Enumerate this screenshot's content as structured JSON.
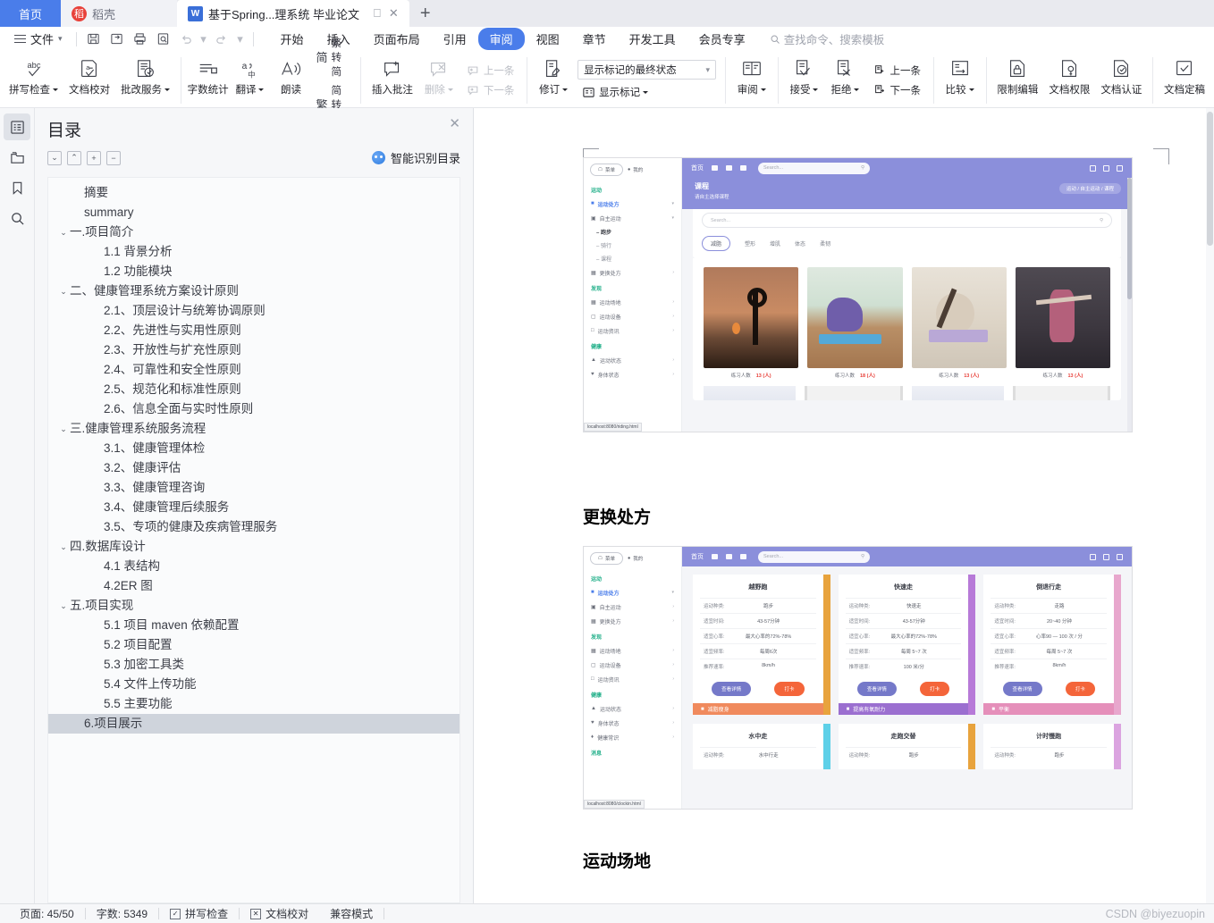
{
  "window": {
    "tabs": [
      {
        "label": "首页",
        "kind": "home"
      },
      {
        "label": "稻壳",
        "kind": "daoke",
        "icon": "daoke-icon"
      },
      {
        "label": "基于Spring...理系统 毕业论文",
        "kind": "document",
        "icon": "wps-writer-icon"
      }
    ],
    "new_tab_label": "+",
    "restore_icon": "restore-icon",
    "close_icon": "close-icon"
  },
  "menubar": {
    "file_label": "文件",
    "quick_access": [
      "save-icon",
      "save-as-icon",
      "print-icon",
      "print-preview-icon",
      "undo-icon",
      "redo-icon",
      "customize-icon"
    ],
    "tabs": [
      {
        "label": "开始",
        "active": false
      },
      {
        "label": "插入",
        "active": false
      },
      {
        "label": "页面布局",
        "active": false
      },
      {
        "label": "引用",
        "active": false
      },
      {
        "label": "审阅",
        "active": true
      },
      {
        "label": "视图",
        "active": false
      },
      {
        "label": "章节",
        "active": false
      },
      {
        "label": "开发工具",
        "active": false
      },
      {
        "label": "会员专享",
        "active": false
      }
    ],
    "search_placeholder": "查找命令、搜索模板",
    "search_icon": "search-icon",
    "accent_color": "#4a7dea"
  },
  "ribbon": {
    "groups": [
      {
        "items": [
          {
            "label": "拼写检查",
            "icon": "spell-check-icon",
            "dropdown": true,
            "disabled": false
          },
          {
            "label": "文档校对",
            "icon": "document-proof-icon",
            "dropdown": false,
            "disabled": false
          },
          {
            "label": "批改服务",
            "icon": "correction-service-icon",
            "dropdown": true,
            "disabled": false
          }
        ]
      },
      {
        "items": [
          {
            "label": "字数统计",
            "icon": "word-count-icon",
            "dropdown": false,
            "disabled": false
          },
          {
            "label": "翻译",
            "icon": "translate-icon",
            "dropdown": true,
            "disabled": false
          },
          {
            "label": "朗读",
            "icon": "read-aloud-icon",
            "dropdown": false,
            "disabled": false
          }
        ],
        "stacked": [
          {
            "label": "繁转简",
            "icon": "trad-to-simp-icon",
            "glyph": "简"
          },
          {
            "label": "简转繁",
            "icon": "simp-to-trad-icon",
            "glyph": "繁"
          }
        ]
      },
      {
        "items": [
          {
            "label": "插入批注",
            "icon": "insert-comment-icon",
            "dropdown": false,
            "disabled": false
          },
          {
            "label": "删除",
            "icon": "delete-comment-icon",
            "dropdown": true,
            "disabled": true
          }
        ],
        "small": [
          {
            "label": "上一条",
            "icon": "previous-comment-icon",
            "disabled": true
          },
          {
            "label": "下一条",
            "icon": "next-comment-icon",
            "disabled": true
          }
        ]
      },
      {
        "items": [
          {
            "label": "修订",
            "icon": "track-changes-icon",
            "dropdown": true,
            "disabled": false
          }
        ],
        "markup": {
          "select_value": "显示标记的最终状态",
          "show_markup_label": "显示标记",
          "show_markup_icon": "show-markup-icon"
        }
      },
      {
        "items": [
          {
            "label": "审阅",
            "icon": "reviewing-pane-icon",
            "dropdown": true,
            "disabled": false
          }
        ]
      },
      {
        "items": [
          {
            "label": "接受",
            "icon": "accept-icon",
            "dropdown": true,
            "disabled": false
          },
          {
            "label": "拒绝",
            "icon": "reject-icon",
            "dropdown": true,
            "disabled": false
          }
        ],
        "small": [
          {
            "label": "上一条",
            "icon": "previous-change-icon",
            "disabled": false
          },
          {
            "label": "下一条",
            "icon": "next-change-icon",
            "disabled": false
          }
        ]
      },
      {
        "items": [
          {
            "label": "比较",
            "icon": "compare-icon",
            "dropdown": true,
            "disabled": false
          }
        ]
      },
      {
        "items": [
          {
            "label": "限制编辑",
            "icon": "restrict-edit-icon",
            "dropdown": false,
            "disabled": false
          },
          {
            "label": "文档权限",
            "icon": "document-permission-icon",
            "dropdown": false,
            "disabled": false
          },
          {
            "label": "文档认证",
            "icon": "document-certify-icon",
            "dropdown": false,
            "disabled": false
          }
        ]
      },
      {
        "items": [
          {
            "label": "文档定稿",
            "icon": "finalize-document-icon",
            "dropdown": false,
            "disabled": false
          }
        ]
      }
    ]
  },
  "icon_rail": [
    {
      "name": "outline-icon",
      "active": true
    },
    {
      "name": "thumbnail-icon",
      "active": false
    },
    {
      "name": "bookmark-icon",
      "active": false
    },
    {
      "name": "find-icon",
      "active": false
    }
  ],
  "nav_pane": {
    "title": "目录",
    "close_icon": "close-icon",
    "tools": [
      {
        "name": "collapse-down-button",
        "glyph": "⌄"
      },
      {
        "name": "collapse-up-button",
        "glyph": "⌃"
      },
      {
        "name": "expand-all-button",
        "glyph": "+"
      },
      {
        "name": "collapse-all-button",
        "glyph": "−"
      }
    ],
    "smart_toc_label": "智能识别目录",
    "smart_toc_icon": "smart-ai-icon",
    "items": [
      {
        "label": "摘要",
        "level": 1,
        "chevron": "",
        "selected": false
      },
      {
        "label": "summary",
        "level": 1,
        "chevron": "",
        "selected": false
      },
      {
        "label": "一.项目简介",
        "level": 0,
        "chevron": "⌄",
        "selected": false
      },
      {
        "label": "1.1 背景分析",
        "level": 2,
        "chevron": "",
        "selected": false
      },
      {
        "label": "1.2 功能模块",
        "level": 2,
        "chevron": "",
        "selected": false
      },
      {
        "label": "二、健康管理系统方案设计原则",
        "level": 0,
        "chevron": "⌄",
        "selected": false
      },
      {
        "label": "2.1、顶层设计与统筹协调原则",
        "level": 2,
        "chevron": "",
        "selected": false
      },
      {
        "label": "2.2、先进性与实用性原则",
        "level": 2,
        "chevron": "",
        "selected": false
      },
      {
        "label": "2.3、开放性与扩充性原则",
        "level": 2,
        "chevron": "",
        "selected": false
      },
      {
        "label": "2.4、可靠性和安全性原则",
        "level": 2,
        "chevron": "",
        "selected": false
      },
      {
        "label": "2.5、规范化和标准性原则",
        "level": 2,
        "chevron": "",
        "selected": false
      },
      {
        "label": "2.6、信息全面与实时性原则",
        "level": 2,
        "chevron": "",
        "selected": false
      },
      {
        "label": "三.健康管理系统服务流程",
        "level": 0,
        "chevron": "⌄",
        "selected": false
      },
      {
        "label": "3.1、健康管理体检",
        "level": 2,
        "chevron": "",
        "selected": false
      },
      {
        "label": "3.2、健康评估",
        "level": 2,
        "chevron": "",
        "selected": false
      },
      {
        "label": "3.3、健康管理咨询",
        "level": 2,
        "chevron": "",
        "selected": false
      },
      {
        "label": "3.4、健康管理后续服务",
        "level": 2,
        "chevron": "",
        "selected": false
      },
      {
        "label": "3.5、专项的健康及疾病管理服务",
        "level": 2,
        "chevron": "",
        "selected": false
      },
      {
        "label": "四.数据库设计",
        "level": 0,
        "chevron": "⌄",
        "selected": false
      },
      {
        "label": "4.1 表结构",
        "level": 2,
        "chevron": "",
        "selected": false
      },
      {
        "label": "4.2ER 图",
        "level": 2,
        "chevron": "",
        "selected": false
      },
      {
        "label": "五.项目实现",
        "level": 0,
        "chevron": "⌄",
        "selected": false
      },
      {
        "label": "5.1 项目 maven 依赖配置",
        "level": 2,
        "chevron": "",
        "selected": false
      },
      {
        "label": "5.2 项目配置",
        "level": 2,
        "chevron": "",
        "selected": false
      },
      {
        "label": "5.3 加密工具类",
        "level": 2,
        "chevron": "",
        "selected": false
      },
      {
        "label": "5.4 文件上传功能",
        "level": 2,
        "chevron": "",
        "selected": false
      },
      {
        "label": "5.5 主要功能",
        "level": 2,
        "chevron": "",
        "selected": false
      },
      {
        "label": "6.项目展示",
        "level": 1,
        "chevron": "",
        "selected": true
      }
    ]
  },
  "document": {
    "headings": [
      {
        "text": "更换处方"
      },
      {
        "text": "运动场地"
      }
    ],
    "screenshot_courses": {
      "sidebar": {
        "menu_pill": "菜单",
        "my_label": "我的",
        "groups": [
          {
            "title": "运动",
            "items": [
              {
                "label": "运动处方",
                "active": true,
                "expanded": true
              },
              {
                "label": "自主运动",
                "active": false,
                "expanded": true
              }
            ],
            "subitems": [
              {
                "label": "跑步",
                "bold": true
              },
              {
                "label": "骑行",
                "bold": false
              },
              {
                "label": "课程",
                "bold": false
              }
            ],
            "after": [
              {
                "label": "更换处方",
                "active": false
              }
            ]
          },
          {
            "title": "发现",
            "items": [
              {
                "label": "运动场地"
              },
              {
                "label": "运动设备"
              },
              {
                "label": "运动资讯"
              }
            ]
          },
          {
            "title": "健康",
            "items": [
              {
                "label": "运动状态"
              },
              {
                "label": "身体状态"
              }
            ]
          }
        ],
        "status_url": "localhost:8080/riding.html"
      },
      "topbar": {
        "brand": "首页",
        "search_placeholder": "Search...",
        "search_icon": "search-icon"
      },
      "banner": {
        "title": "课程",
        "subtitle": "请自主选择课程",
        "breadcrumb": "运动 / 自主运动 / 课程"
      },
      "search_placeholder": "Search...",
      "filters": [
        {
          "label": "减脂",
          "active": true
        },
        {
          "label": "塑形",
          "active": false
        },
        {
          "label": "增肌",
          "active": false
        },
        {
          "label": "体态",
          "active": false
        },
        {
          "label": "柔韧",
          "active": false
        }
      ],
      "cards": [
        {
          "caption": "练习人数",
          "count": "13 (人)"
        },
        {
          "caption": "练习人数",
          "count": "18 (人)"
        },
        {
          "caption": "练习人数",
          "count": "13 (人)"
        },
        {
          "caption": "练习人数",
          "count": "13 (人)"
        }
      ]
    },
    "screenshot_prescription": {
      "sidebar": {
        "menu_pill": "菜单",
        "my_label": "我的",
        "groups": [
          {
            "title": "运动",
            "items": [
              {
                "label": "运动处方",
                "active": true
              },
              {
                "label": "自主运动",
                "active": false
              },
              {
                "label": "更换处方",
                "active": false
              }
            ]
          },
          {
            "title": "发现",
            "items": [
              {
                "label": "运动场地"
              },
              {
                "label": "运动设备"
              },
              {
                "label": "运动资讯"
              }
            ]
          },
          {
            "title": "健康",
            "items": [
              {
                "label": "运动状态"
              },
              {
                "label": "身体状态"
              },
              {
                "label": "健康常识"
              }
            ]
          },
          {
            "title": "消息",
            "items": []
          }
        ],
        "status_url": "localhost:8080/clockin.html"
      },
      "topbar": {
        "brand": "首页",
        "search_placeholder": "Search...",
        "search_icon": "search-icon"
      },
      "row1": [
        {
          "title": "越野跑",
          "tag": "减脂瘦身",
          "tag_color": "#f08a5d",
          "edge_color": "#e8a33d",
          "rows": [
            {
              "k": "运动种类:",
              "v": "跑步"
            },
            {
              "k": "适宜时间:",
              "v": "43-57分钟"
            },
            {
              "k": "适宜心率:",
              "v": "最大心率的72%-78%"
            },
            {
              "k": "适宜频率:",
              "v": "每周6次"
            },
            {
              "k": "推荐速率:",
              "v": "8km/h"
            }
          ],
          "buttons": [
            "查看详情",
            "打卡"
          ]
        },
        {
          "title": "快速走",
          "tag": "提高有氧耐力",
          "tag_color": "#9b6fd0",
          "edge_color": "#b77ad8",
          "rows": [
            {
              "k": "运动种类:",
              "v": "快速走"
            },
            {
              "k": "适宜时间:",
              "v": "43-57分钟"
            },
            {
              "k": "适宜心率:",
              "v": "最大心率的72%-78%"
            },
            {
              "k": "适宜频率:",
              "v": "每周 5~7 次"
            },
            {
              "k": "推荐速率:",
              "v": "100 米/分"
            }
          ],
          "buttons": [
            "查看详情",
            "打卡"
          ]
        },
        {
          "title": "倒退行走",
          "tag": "平衡",
          "tag_color": "#e58fba",
          "edge_color": "#e8a7cd",
          "rows": [
            {
              "k": "运动种类:",
              "v": "走路"
            },
            {
              "k": "适宜时间:",
              "v": "20~40 分钟"
            },
            {
              "k": "适宜心率:",
              "v": "心率90 — 100 次 / 分"
            },
            {
              "k": "适宜频率:",
              "v": "每周 5~7 次"
            },
            {
              "k": "推荐速率:",
              "v": "8km/h"
            }
          ],
          "buttons": [
            "查看详情",
            "打卡"
          ]
        }
      ],
      "row2": [
        {
          "title": "水中走",
          "edge_color": "#5ed0e8",
          "rows": [
            {
              "k": "运动种类:",
              "v": "水中行走"
            }
          ]
        },
        {
          "title": "走跑交替",
          "edge_color": "#e8a33d",
          "rows": [
            {
              "k": "运动种类:",
              "v": "跑步"
            }
          ]
        },
        {
          "title": "计时慢跑",
          "edge_color": "#dba4e0",
          "rows": [
            {
              "k": "运动种类:",
              "v": "跑步"
            }
          ]
        }
      ]
    }
  },
  "statusbar": {
    "page_label": "页面: 45/50",
    "word_count_label": "字数: 5349",
    "spell_check_label": "拼写检查",
    "spell_check_icon": "spell-check-status-icon",
    "proofread_label": "文档校对",
    "proofread_icon": "proofread-status-icon",
    "compat_label": "兼容模式",
    "watermark": "CSDN @biyezuopin"
  }
}
